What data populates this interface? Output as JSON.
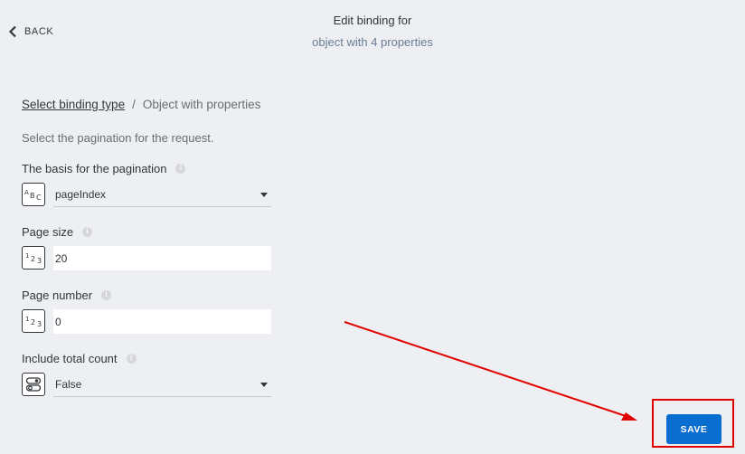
{
  "header": {
    "back_label": "BACK",
    "title": "Edit binding for",
    "subtitle": "object with 4 properties"
  },
  "breadcrumb": {
    "link": "Select binding type",
    "separator": "/",
    "current": "Object with properties"
  },
  "description": "Select the pagination for the request.",
  "fields": {
    "basis": {
      "label": "The basis for the pagination",
      "type_icon": "abc-text-icon",
      "type_text": "ABC",
      "value": "pageIndex"
    },
    "page_size": {
      "label": "Page size",
      "type_icon": "number-icon",
      "type_text": "123",
      "value": "20"
    },
    "page_number": {
      "label": "Page number",
      "type_icon": "number-icon",
      "type_text": "123",
      "value": "0"
    },
    "total_count": {
      "label": "Include total count",
      "type_icon": "toggle-boolean-icon",
      "value": "False"
    }
  },
  "actions": {
    "save_label": "SAVE"
  },
  "annotation": {
    "color": "#e00000"
  },
  "colors": {
    "accent": "#0a6ed1",
    "background": "#eeeff2"
  }
}
